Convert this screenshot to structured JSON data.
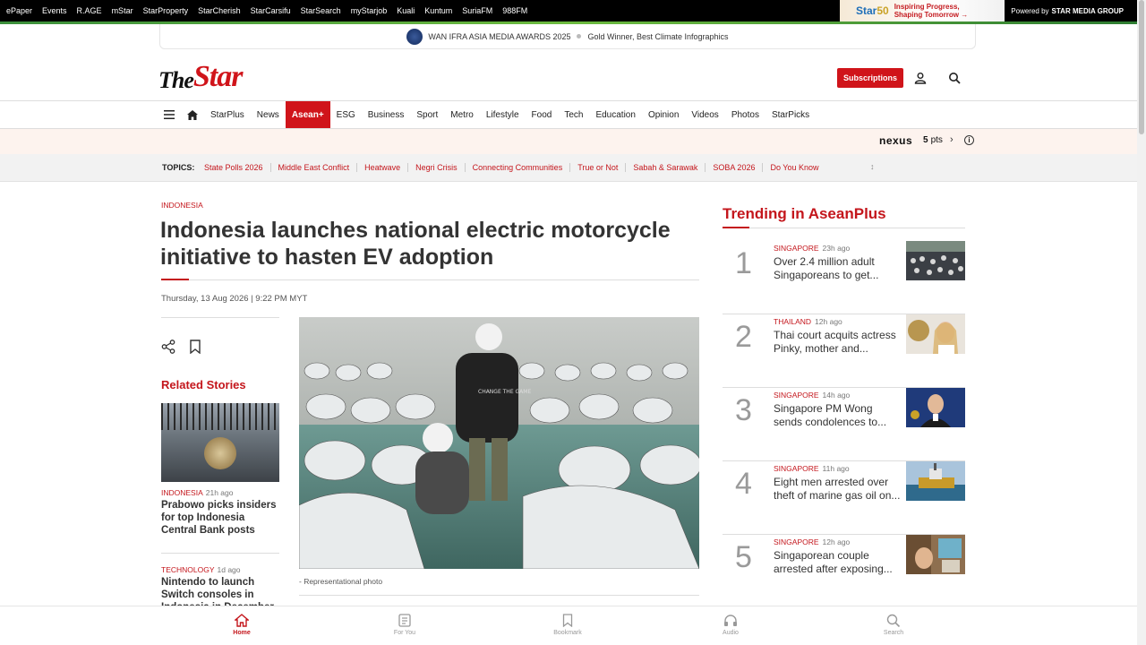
{
  "topbar": {
    "links": [
      "ePaper",
      "Events",
      "R.AGE",
      "mStar",
      "StarProperty",
      "StarCherish",
      "StarCarsifu",
      "StarSearch",
      "myStarjob",
      "Kuali",
      "Kuntum",
      "SuriaFM",
      "988FM"
    ],
    "promo_line1": "Inspiring Progress,",
    "promo_line2": "Shaping Tomorrow →",
    "powered_prefix": "Powered by",
    "powered_brand": "STAR MEDIA GROUP"
  },
  "award": {
    "title": "WAN IFRA ASIA MEDIA AWARDS 2025",
    "detail": "Gold Winner, Best Climate Infographics"
  },
  "header": {
    "logo_the": "The",
    "logo_star": "Star",
    "subscribe_label": "Subscriptions"
  },
  "nav": {
    "items": [
      "StarPlus",
      "News",
      "Asean+",
      "ESG",
      "Business",
      "Sport",
      "Metro",
      "Lifestyle",
      "Food",
      "Tech",
      "Education",
      "Opinion",
      "Videos",
      "Photos",
      "StarPicks"
    ],
    "active": "Asean+"
  },
  "nexus": {
    "brand": "nexus",
    "points": "5",
    "points_unit": "pts"
  },
  "topics": {
    "label": "TOPICS:",
    "items": [
      "State Polls 2026",
      "Middle East Conflict",
      "Heatwave",
      "Negri Crisis",
      "Connecting Communities",
      "True or Not",
      "Sabah & Sarawak",
      "SOBA 2026",
      "Do You Know"
    ]
  },
  "article": {
    "kicker": "INDONESIA",
    "headline": "Indonesia launches national electric motorcycle initiative to hasten EV adoption",
    "date": "Thursday, 13 Aug 2026 | 9:22 PM MYT",
    "caption": "- Representational photo",
    "shirt_text": "CHANGE THE GAME"
  },
  "related": {
    "title": "Related Stories",
    "items": [
      {
        "category": "INDONESIA",
        "ago": "21h ago",
        "headline": "Prabowo picks insiders for top Indonesia Central Bank posts"
      },
      {
        "category": "TECHNOLOGY",
        "ago": "1d ago",
        "headline": "Nintendo to launch Switch consoles in Indonesia in December"
      }
    ]
  },
  "trending": {
    "title": "Trending in AseanPlus",
    "items": [
      {
        "rank": "1",
        "category": "SINGAPORE",
        "ago": "23h ago",
        "headline": "Over 2.4 million adult Singaporeans to get..."
      },
      {
        "rank": "2",
        "category": "THAILAND",
        "ago": "12h ago",
        "headline": "Thai court acquits actress Pinky, mother and..."
      },
      {
        "rank": "3",
        "category": "SINGAPORE",
        "ago": "14h ago",
        "headline": "Singapore PM Wong sends condolences to..."
      },
      {
        "rank": "4",
        "category": "SINGAPORE",
        "ago": "11h ago",
        "headline": "Eight men arrested over theft of marine gas oil on..."
      },
      {
        "rank": "5",
        "category": "SINGAPORE",
        "ago": "12h ago",
        "headline": "Singaporean couple arrested after exposing..."
      }
    ]
  },
  "bottomnav": {
    "items": [
      "Home",
      "For You",
      "Bookmark",
      "Audio",
      "Search"
    ],
    "active": "Home"
  },
  "colors": {
    "brand_red": "#d0141a",
    "link_red": "#c4161c",
    "nexus_bg": "#fdf3ee",
    "topics_bg": "#f2f2f2"
  }
}
